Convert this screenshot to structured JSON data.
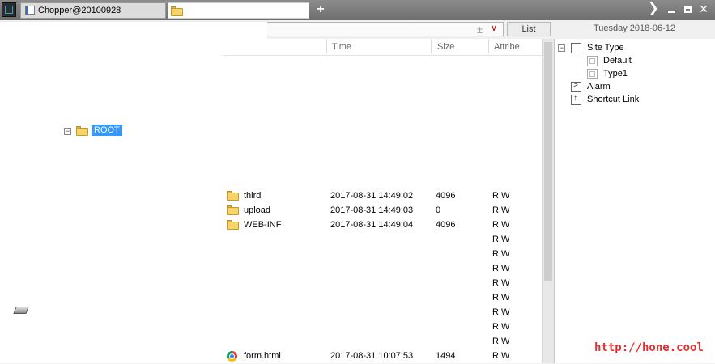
{
  "tabs": [
    {
      "label": "Chopper@20100928"
    },
    {
      "label": ""
    }
  ],
  "toolbar": {
    "plus_symbol": "±",
    "dropdown_symbol": "∨",
    "list_button": "List",
    "date": "Tuesday 2018-06-12"
  },
  "tree": {
    "root_label": "ROOT",
    "expander": "−"
  },
  "file_list": {
    "columns": [
      "Time",
      "Size",
      "Attribe"
    ],
    "rows": [
      {
        "name": "third",
        "time": "2017-08-31 14:49:02",
        "size": "4096",
        "attr": "R W",
        "icon": "folder-icon"
      },
      {
        "name": "upload",
        "time": "2017-08-31 14:49:03",
        "size": "0",
        "attr": "R W",
        "icon": "folder-icon"
      },
      {
        "name": "WEB-INF",
        "time": "2017-08-31 14:49:04",
        "size": "4096",
        "attr": "R W",
        "icon": "folder-icon"
      },
      {
        "name": "",
        "time": "",
        "size": "",
        "attr": "R W",
        "icon": ""
      },
      {
        "name": "",
        "time": "",
        "size": "",
        "attr": "R W",
        "icon": ""
      },
      {
        "name": "",
        "time": "",
        "size": "",
        "attr": "R W",
        "icon": ""
      },
      {
        "name": "",
        "time": "",
        "size": "",
        "attr": "R W",
        "icon": ""
      },
      {
        "name": "",
        "time": "",
        "size": "",
        "attr": "R W",
        "icon": ""
      },
      {
        "name": "",
        "time": "",
        "size": "",
        "attr": "R W",
        "icon": ""
      },
      {
        "name": "",
        "time": "",
        "size": "",
        "attr": "R W",
        "icon": ""
      },
      {
        "name": "",
        "time": "",
        "size": "",
        "attr": "R W",
        "icon": ""
      },
      {
        "name": "form.html",
        "time": "2017-08-31 10:07:53",
        "size": "1494",
        "attr": "R W",
        "icon": "chrome-icon"
      }
    ]
  },
  "site_tree": {
    "expander": "−",
    "site_type": "Site Type",
    "children": [
      "Default",
      "Type1"
    ],
    "alarm": "Alarm",
    "shortcut": "Shortcut Link"
  },
  "watermark": "http://hone.cool",
  "colors": {
    "selection": "#3399ff",
    "watermark": "#e03030"
  }
}
